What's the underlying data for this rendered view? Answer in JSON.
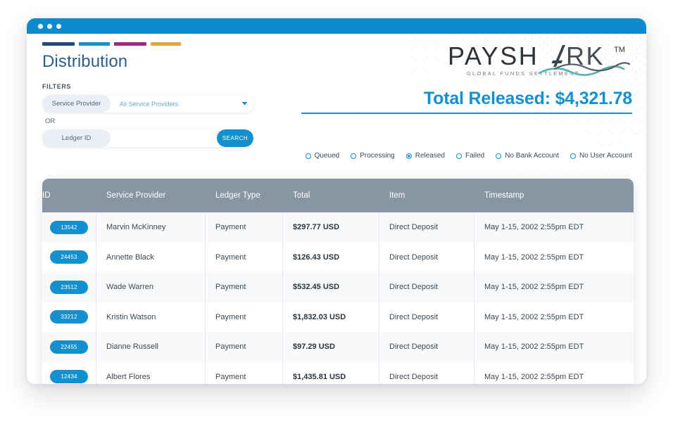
{
  "window": {
    "dots_count": 3,
    "titlebar_color": "#0d8ccd"
  },
  "header": {
    "page_title": "Distribution",
    "brand_bar_colors": [
      "#1d4e79",
      "#1590cf",
      "#a8257f",
      "#e8a33d"
    ]
  },
  "filters": {
    "section_label": "FILTERS",
    "or_label": "OR",
    "service_provider": {
      "tag_label": "Service Provider",
      "value": "All Service Providers",
      "caret_icon": "chevron-down-icon"
    },
    "ledger": {
      "tag_label": "Ledger ID",
      "value": "",
      "placeholder": "",
      "search_label": "SEARCH"
    }
  },
  "brand": {
    "logo_text": "PAYSHARK",
    "logo_tagline": "GLOBAL FUNDS SETTLEMENT",
    "trademark": "TM",
    "accent_color": "#1590cf",
    "wave_color": "#4fb3b0"
  },
  "summary": {
    "total_label": "Total Released:",
    "total_amount": "$4,321.78",
    "total_line": "Total Released: $4,321.78"
  },
  "status_filters": {
    "options": [
      {
        "label": "Queued",
        "selected": false
      },
      {
        "label": "Processing",
        "selected": false
      },
      {
        "label": "Released",
        "selected": true
      },
      {
        "label": "Failed",
        "selected": false
      },
      {
        "label": "No Bank Account",
        "selected": false
      },
      {
        "label": "No User Account",
        "selected": false
      }
    ]
  },
  "table": {
    "columns": [
      "ID",
      "Service Provider",
      "Ledger Type",
      "Total",
      "Item",
      "Timestamp"
    ],
    "rows": [
      {
        "id": "13542",
        "service_provider": "Marvin McKinney",
        "ledger_type": "Payment",
        "total": "$297.77 USD",
        "item": "Direct Deposit",
        "timestamp": "May 1-15, 2002 2:55pm EDT"
      },
      {
        "id": "24453",
        "service_provider": "Annette Black",
        "ledger_type": "Payment",
        "total": "$126.43 USD",
        "item": "Direct Deposit",
        "timestamp": "May 1-15, 2002 2:55pm EDT"
      },
      {
        "id": "23512",
        "service_provider": "Wade Warren",
        "ledger_type": "Payment",
        "total": "$532.45 USD",
        "item": "Direct Deposit",
        "timestamp": "May 1-15, 2002 2:55pm EDT"
      },
      {
        "id": "33212",
        "service_provider": "Kristin Watson",
        "ledger_type": "Payment",
        "total": "$1,832.03 USD",
        "item": "Direct Deposit",
        "timestamp": "May 1-15, 2002 2:55pm EDT"
      },
      {
        "id": "22455",
        "service_provider": "Dianne Russell",
        "ledger_type": "Payment",
        "total": "$97.29 USD",
        "item": "Direct Deposit",
        "timestamp": "May 1-15, 2002 2:55pm EDT"
      },
      {
        "id": "12434",
        "service_provider": "Albert Flores",
        "ledger_type": "Payment",
        "total": "$1,435.81 USD",
        "item": "Direct Deposit",
        "timestamp": "May 1-15, 2002 2:55pm EDT"
      }
    ]
  }
}
